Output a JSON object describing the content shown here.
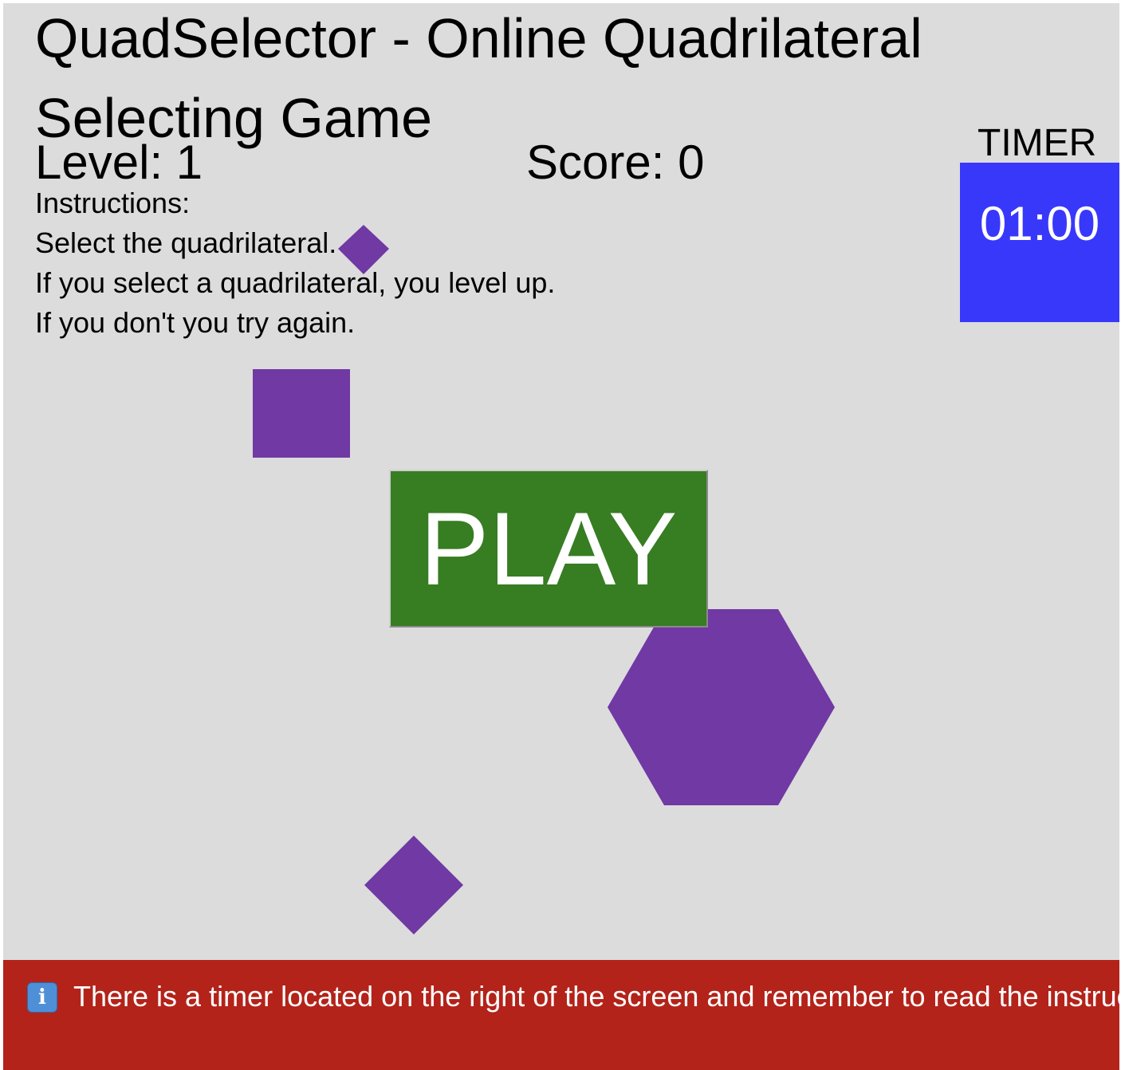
{
  "header": {
    "title": "QuadSelector - Online Quadrilateral Selecting Game",
    "level": "Level: 1",
    "score": "Score: 0"
  },
  "instructions": {
    "heading": "Instructions:",
    "lines": [
      "Select the quadrilateral.",
      "If you select a quadrilateral, you level up.",
      "If you don't you try again."
    ]
  },
  "timer": {
    "label": "TIMER",
    "value": "01:00",
    "color": "#3838fb"
  },
  "play_button": {
    "label": "PLAY",
    "color": "#377d22"
  },
  "shapes": {
    "color": "#7039a3",
    "items": [
      "small-diamond",
      "square",
      "hexagon",
      "diamond"
    ]
  },
  "banner": {
    "icon": "info-icon",
    "text": "There is a timer located on the right of the screen and remember to read the instructions",
    "color": "#b3231a"
  }
}
